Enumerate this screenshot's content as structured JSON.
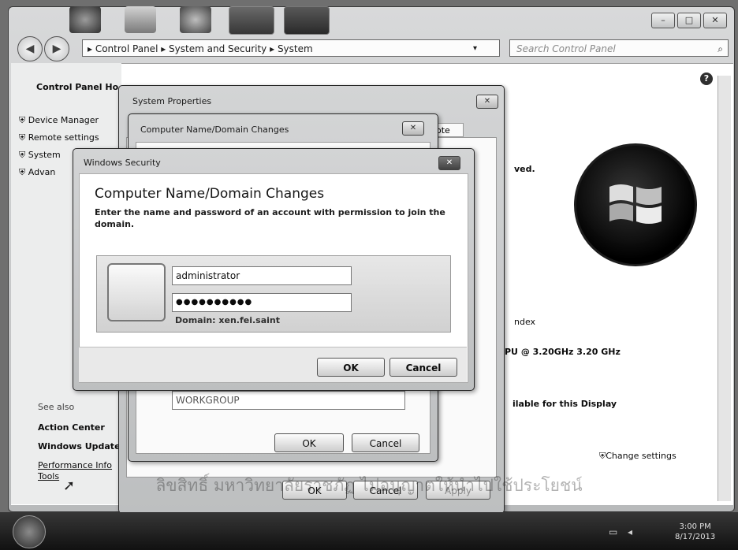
{
  "window": {
    "breadcrumb": "▸ Control Panel ▸ System and Security ▸ System",
    "search_placeholder": "Search Control Panel",
    "help_icon": "help-icon"
  },
  "left_pane": {
    "home_link": "Control Panel Ho",
    "tasks": [
      "Device Manager",
      "Remote settings",
      "System",
      "Advan"
    ],
    "see_also_label": "See also",
    "see_also": [
      "Action Center",
      "Windows Update",
      "Performance Info",
      "Tools"
    ]
  },
  "right_pane": {
    "text_reserved": "ved.",
    "text_index": "ndex",
    "text_cpu": "PU @ 3.20GHz  3.20 GHz",
    "text_display": "ilable for this Display",
    "change_settings": "Change settings"
  },
  "system_properties": {
    "title": "System Properties",
    "ok": "OK",
    "cancel": "Cancel",
    "apply": "Apply",
    "tab_partial": "ote"
  },
  "name_changes": {
    "title": "Computer Name/Domain Changes",
    "workgroup_value": "WORKGROUP",
    "ok": "OK",
    "cancel": "Cancel"
  },
  "security": {
    "title": "Windows Security",
    "heading": "Computer Name/Domain Changes",
    "description": "Enter the name and password of an account with permission to join the domain.",
    "username": "administrator",
    "password": "●●●●●●●●●●",
    "domain": "Domain: xen.fei.saint",
    "ok": "OK",
    "cancel": "Cancel"
  },
  "taskbar": {
    "clock_time": "3:00 PM",
    "clock_date": "8/17/2013"
  },
  "watermark": "ลิขสิทธิ์ มหาวิทยาลัยราชภัฏ ไม่อนุญาตให้นำไปใช้ประโยชน์"
}
